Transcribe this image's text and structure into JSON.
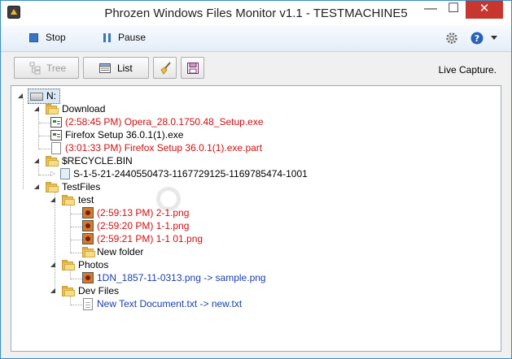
{
  "window": {
    "title": "Phrozen Windows Files Monitor v1.1 - TESTMACHINE5"
  },
  "window_controls": {
    "minimize": "—",
    "maximize": "☐",
    "close": "✕"
  },
  "menu": {
    "stop_label": "Stop",
    "pause_label": "Pause"
  },
  "toolbar": {
    "tree_label": "Tree",
    "list_label": "List",
    "status_label": "Live Capture."
  },
  "tree": {
    "root": "N:",
    "nodes": [
      {
        "label": "Download"
      },
      {
        "label": "(2:58:45 PM) Opera_28.0.1750.48_Setup.exe"
      },
      {
        "label": "Firefox Setup 36.0.1(1).exe"
      },
      {
        "label": "(3:01:33 PM) Firefox Setup 36.0.1(1).exe.part"
      },
      {
        "label": "$RECYCLE.BIN"
      },
      {
        "label": "S-1-5-21-2440550473-1167729125-1169785474-1001"
      },
      {
        "label": "TestFiles"
      },
      {
        "label": "test"
      },
      {
        "label": "(2:59:13 PM) 2-1.png"
      },
      {
        "label": "(2:59:20 PM) 1-1.png"
      },
      {
        "label": "(2:59:21 PM) 1-1 01.png"
      },
      {
        "label": "New folder"
      },
      {
        "label": "Photos"
      },
      {
        "label": "1DN_1857-11-0313.png -> sample.png"
      },
      {
        "label": "Dev Files"
      },
      {
        "label": "New Text Document.txt -> new.txt"
      }
    ]
  },
  "colors": {
    "created": "#d01010",
    "renamed": "#1a3fae",
    "accent": "#3a8cc6",
    "close": "#c7372f"
  },
  "icons": [
    "app-icon",
    "stop-icon",
    "pause-icon",
    "settings-gear-icon",
    "help-icon",
    "tree-icon",
    "list-icon",
    "broom-icon",
    "save-icon",
    "drive-icon",
    "folder-icon",
    "exe-icon",
    "document-icon",
    "image-icon",
    "recycle-icon"
  ]
}
